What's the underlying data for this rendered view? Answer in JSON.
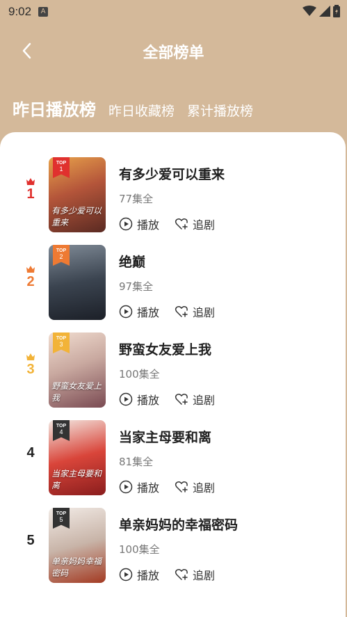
{
  "status_bar": {
    "time": "9:02",
    "notification_badge": "A"
  },
  "header": {
    "title": "全部榜单"
  },
  "tabs": [
    {
      "label": "昨日播放榜",
      "active": true
    },
    {
      "label": "昨日收藏榜",
      "active": false
    },
    {
      "label": "累计播放榜",
      "active": false
    }
  ],
  "colors": {
    "header_bg": "#d4b99a",
    "rank1": "#e0312e",
    "rank2": "#ee7a33",
    "rank3": "#f2b338",
    "rank_other": "#222222"
  },
  "items": [
    {
      "rank": "1",
      "title": "有多少爱可以重来",
      "episodes": "77集全",
      "play_label": "播放",
      "follow_label": "追剧",
      "badge_top": "TOP",
      "badge_num": "1",
      "poster_caption": "有多少爱可以重来"
    },
    {
      "rank": "2",
      "title": "绝巅",
      "episodes": "97集全",
      "play_label": "播放",
      "follow_label": "追剧",
      "badge_top": "TOP",
      "badge_num": "2",
      "poster_caption": ""
    },
    {
      "rank": "3",
      "title": "野蛮女友爱上我",
      "episodes": "100集全",
      "play_label": "播放",
      "follow_label": "追剧",
      "badge_top": "TOP",
      "badge_num": "3",
      "poster_caption": "野蛮女友爱上我"
    },
    {
      "rank": "4",
      "title": "当家主母要和离",
      "episodes": "81集全",
      "play_label": "播放",
      "follow_label": "追剧",
      "badge_top": "TOP",
      "badge_num": "4",
      "poster_caption": "当家主母要和离"
    },
    {
      "rank": "5",
      "title": "单亲妈妈的幸福密码",
      "episodes": "100集全",
      "play_label": "播放",
      "follow_label": "追剧",
      "badge_top": "TOP",
      "badge_num": "5",
      "poster_caption": "单亲妈妈幸福密码"
    }
  ]
}
